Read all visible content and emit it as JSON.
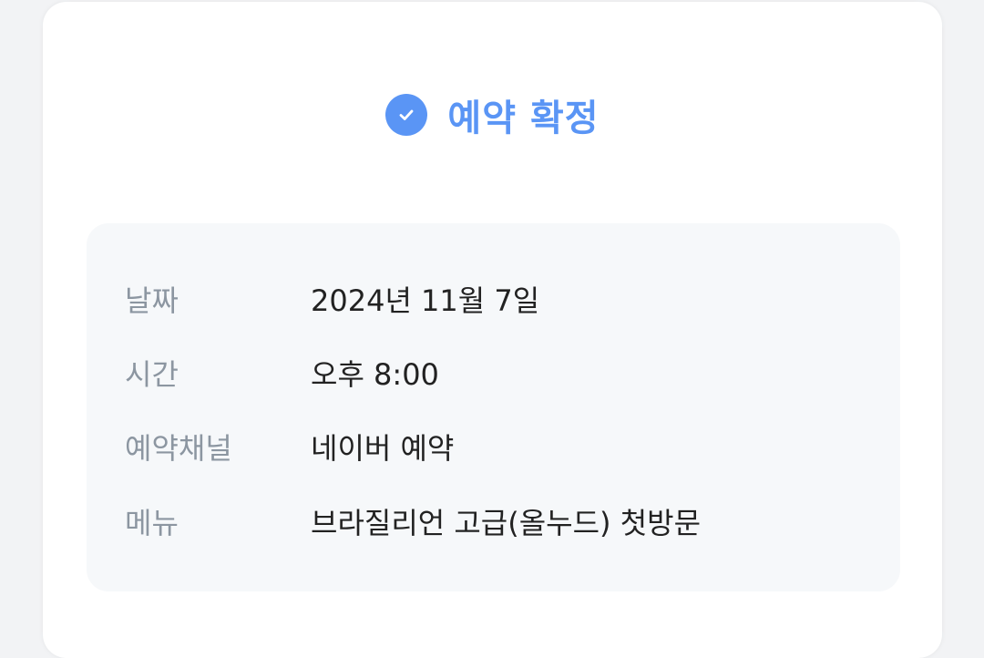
{
  "header": {
    "title": "예약 확정",
    "icon": "check-circle-icon",
    "accent_color": "#5a95f5"
  },
  "details": [
    {
      "label": "날짜",
      "value": "2024년 11월 7일"
    },
    {
      "label": "시간",
      "value": "오후 8:00"
    },
    {
      "label": "예약채널",
      "value": "네이버 예약"
    },
    {
      "label": "메뉴",
      "value": "브라질리언 고급(올누드) 첫방문"
    }
  ]
}
